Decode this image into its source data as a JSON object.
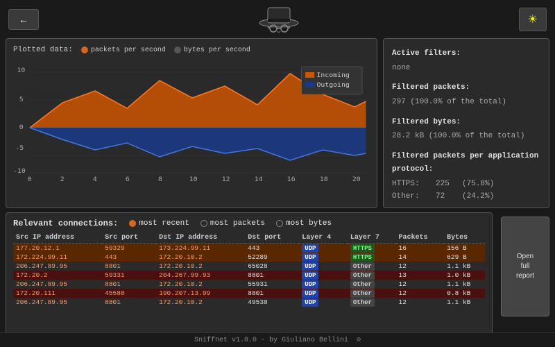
{
  "header": {
    "back_label": "←",
    "theme_label": "☀",
    "logo_hat": "🎩"
  },
  "chart": {
    "title": "Plotted data:",
    "legend": [
      {
        "label": "packets per second",
        "color": "#d2691e",
        "type": "orange"
      },
      {
        "label": "bytes per second",
        "color": "#555",
        "type": "gray"
      }
    ],
    "area_legend": [
      {
        "label": "Incoming",
        "color": "#cc5500"
      },
      {
        "label": "Outgoing",
        "color": "#3355aa"
      }
    ],
    "x_labels": [
      "0",
      "2",
      "4",
      "6",
      "8",
      "10",
      "12",
      "14",
      "16",
      "18",
      "20"
    ]
  },
  "info_panel": {
    "active_filters_title": "Active filters:",
    "active_filters_value": "none",
    "filtered_packets_title": "Filtered packets:",
    "filtered_packets_value": "297 (100.0% of the total)",
    "filtered_bytes_title": "Filtered bytes:",
    "filtered_bytes_value": "28.2 kB (100.0% of the total)",
    "filtered_packets_proto_title": "Filtered packets per application protocol:",
    "proto_rows": [
      {
        "label": "HTTPS:",
        "count": "225",
        "pct": "(75.8%)"
      },
      {
        "label": "Other:",
        "count": "72",
        "pct": "(24.2%)"
      }
    ]
  },
  "connections": {
    "title": "Relevant connections:",
    "filters": [
      {
        "label": "most recent",
        "active": true
      },
      {
        "label": "most packets",
        "active": false
      },
      {
        "label": "most bytes",
        "active": false
      }
    ],
    "columns": [
      "Src IP address",
      "Src port",
      "Dst IP address",
      "Dst port",
      "Layer 4",
      "Layer 7",
      "Packets",
      "Bytes"
    ],
    "rows": [
      {
        "src_ip": "177.20.12.1",
        "src_port": "59329",
        "dst_ip": "173.224.99.11",
        "dst_port": "443",
        "l4": "UDP",
        "l7": "HTTPS",
        "packets": "16",
        "bytes": "156 B",
        "highlight": "orange"
      },
      {
        "src_ip": "172.224.99.11",
        "src_port": "443",
        "dst_ip": "172.20.10.2",
        "dst_port": "52289",
        "l4": "UDP",
        "l7": "HTTPS",
        "packets": "14",
        "bytes": "629 B",
        "highlight": "orange"
      },
      {
        "src_ip": "206.247.89.95",
        "src_port": "8801",
        "dst_ip": "172.20.10.2",
        "dst_port": "65028",
        "l4": "UDP",
        "l7": "Other",
        "packets": "12",
        "bytes": "1.1 kB",
        "highlight": "normal"
      },
      {
        "src_ip": "172.20.2",
        "src_port": "59331",
        "dst_ip": "204.267.99.93",
        "dst_port": "8801",
        "l4": "UDP",
        "l7": "Other",
        "packets": "13",
        "bytes": "1.0 kB",
        "highlight": "red"
      },
      {
        "src_ip": "206.247.89.95",
        "src_port": "8801",
        "dst_ip": "172.20.10.2",
        "dst_port": "55931",
        "l4": "UDP",
        "l7": "Other",
        "packets": "12",
        "bytes": "1.1 kB",
        "highlight": "normal"
      },
      {
        "src_ip": "172.20.111",
        "src_port": "45588",
        "dst_ip": "190.207.13.99",
        "dst_port": "8801",
        "l4": "UDP",
        "l7": "Other",
        "packets": "12",
        "bytes": "0.8 kB",
        "highlight": "red"
      },
      {
        "src_ip": "206.247.89.95",
        "src_port": "8801",
        "dst_ip": "172.20.10.2",
        "dst_port": "49538",
        "l4": "UDP",
        "l7": "Other",
        "packets": "12",
        "bytes": "1.1 kB",
        "highlight": "normal"
      }
    ],
    "open_report_label": "Open\nfull\nreport"
  },
  "footer": {
    "text": "Sniffnet v1.0.0 - by Giuliano Bellini"
  }
}
